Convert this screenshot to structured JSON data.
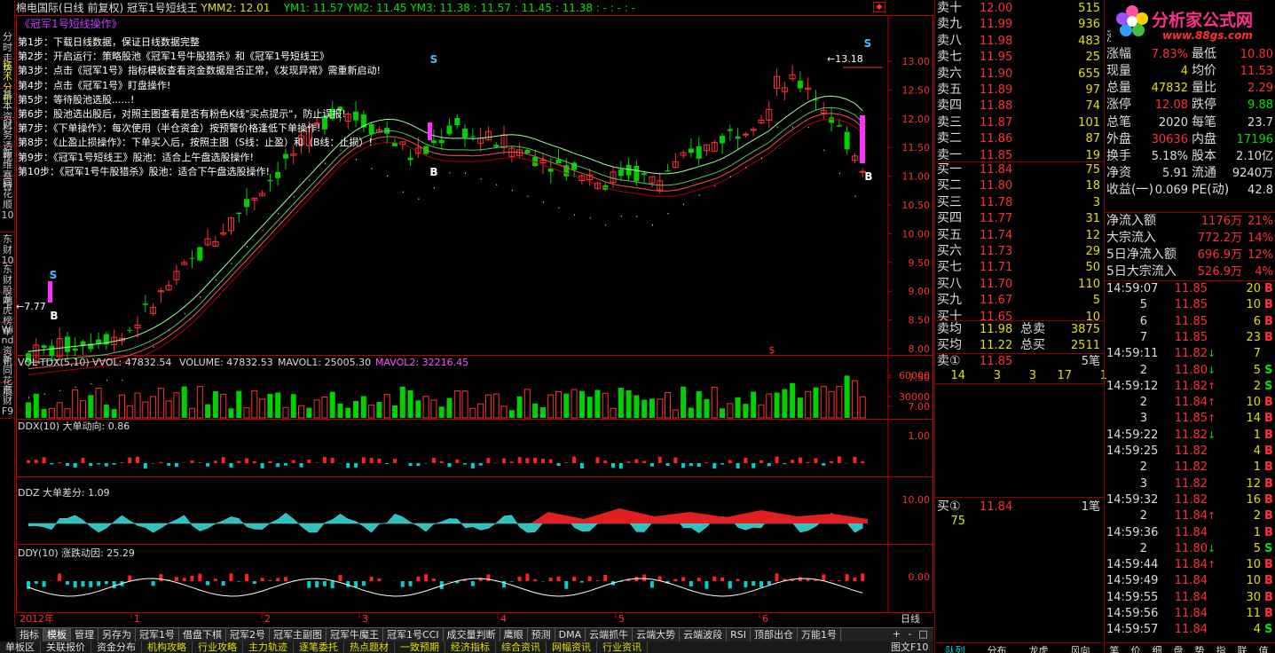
{
  "left_tabs": [
    "分时走势",
    "技术分析",
    "基本资料",
    "财务透视",
    "新维赛特",
    "同花顺10",
    "东财10",
    "东财股吧",
    "龙虎榜单",
    "Wind资讯",
    "新同花顺",
    "东财F9"
  ],
  "title": {
    "app": "棉电国际(日线 前复权)",
    "indicator": "冠军1号短线王",
    "ymm2": "YMM2: 12.01",
    "ym1": "YM1: 11.57",
    "ym2": "YM2: 11.45",
    "ym3": "YM3: 11.38",
    "extra": ": 11.57  : 11.45  : 11.38  : -  : -  : -"
  },
  "chart_title": "《冠军1号短线操作》",
  "steps": [
    "第1步：下载日线数据，保证日线数据完整",
    "第2步：开启运行：策略股池《冠军1号牛股猎杀》和《冠军1号短线王》",
    "第3步：点击《冠军1号》指标模板查看资金数据是否正常，《发现异常》需重新启动!",
    "第4步：点击《冠军1号》盯盘操作!",
    "第5步：等待股池选股......!",
    "第6步：股池选出股后，对照主图查看是否有粉色K线\"买点提示\"，防止误报!",
    "第7步：《下单操作》：每次使用（半仓资金）按预警价格逢低下单操作!",
    "第8步：《止盈止损操作》：下单买入后，按照主图（S线：止盈）和（B线：止损）!",
    "第9步：《冠军1号短线王》股池：适合上午盘选股操作!",
    "第10步：《冠军1号牛股猎杀》股池：适合下午盘选股操作!"
  ],
  "price_axis": [
    "13.00",
    "12.50",
    "12.00",
    "11.50",
    "11.00",
    "10.50",
    "10.00",
    "9.50",
    "9.00",
    "8.50",
    "8.00",
    "7.50",
    "7.00"
  ],
  "price_marks": {
    "high": "13.18",
    "low": "7.77",
    "s": "S",
    "b": "B"
  },
  "vol_header": {
    "name": "VOL-TDX(5,10)",
    "vvol": "VVOL: 47832.54",
    "volume": "VOLUME: 47832.53",
    "mavol1": "MAVOL1: 25005.30",
    "mavol2": "MAVOL2: 32216.45"
  },
  "vol_axis": [
    "60000",
    "30000"
  ],
  "ddx_header": "DDX(10) 大单动向: 0.86",
  "ddx_axis": [
    "1.00"
  ],
  "ddz_header": "DDZ 大单差分: 1.09",
  "ddz_axis": [
    "10.00"
  ],
  "ddy_header": "DDY(10) 涨跌动因: 25.29",
  "ddy_axis": [
    "0.00"
  ],
  "x_axis": {
    "year": "2012年",
    "months": [
      "1",
      "2",
      "3",
      "4",
      "5",
      "6"
    ],
    "period": "日线"
  },
  "bottom_tabs": [
    "指标",
    "模板",
    "管理",
    "另存为",
    "冠军1号",
    "借盘下棋",
    "冠军2号",
    "冠军主副图",
    "冠军牛魔王",
    "冠军1号CCI",
    "成交量判断",
    "鹰眼",
    "预测",
    "DMA",
    "云端抓牛",
    "云端大势",
    "云端波段",
    "RSI",
    "顶部出仓",
    "万能1号"
  ],
  "news_tabs": [
    "单板区",
    "关联报价",
    "资金分布",
    "机构攻略",
    "行业攻略",
    "主力轨迹",
    "逐笔委托",
    "热点题材",
    "一致预期",
    "经济指标",
    "综合资讯",
    "网幅资讯",
    "行业资讯"
  ],
  "orderbook": {
    "sells": [
      {
        "label": "卖十",
        "price": "12.00",
        "vol": "515"
      },
      {
        "label": "卖九",
        "price": "11.99",
        "vol": "936"
      },
      {
        "label": "卖八",
        "price": "11.98",
        "vol": "483"
      },
      {
        "label": "卖七",
        "price": "11.95",
        "vol": "25"
      },
      {
        "label": "卖六",
        "price": "11.90",
        "vol": "655"
      },
      {
        "label": "卖五",
        "price": "11.89",
        "vol": "97"
      },
      {
        "label": "卖四",
        "price": "11.88",
        "vol": "74"
      },
      {
        "label": "卖三",
        "price": "11.87",
        "vol": "101"
      },
      {
        "label": "卖二",
        "price": "11.86",
        "vol": "87"
      },
      {
        "label": "卖一",
        "price": "11.85",
        "vol": "19"
      }
    ],
    "buys": [
      {
        "label": "买一",
        "price": "11.84",
        "vol": "75"
      },
      {
        "label": "买二",
        "price": "11.80",
        "vol": "18"
      },
      {
        "label": "买三",
        "price": "11.78",
        "vol": "3"
      },
      {
        "label": "买四",
        "price": "11.77",
        "vol": "31"
      },
      {
        "label": "买五",
        "price": "11.74",
        "vol": "12"
      },
      {
        "label": "买六",
        "price": "11.73",
        "vol": "29"
      },
      {
        "label": "买七",
        "price": "11.71",
        "vol": "50"
      },
      {
        "label": "买八",
        "price": "11.70",
        "vol": "110"
      },
      {
        "label": "买九",
        "price": "11.67",
        "vol": "5"
      },
      {
        "label": "买十",
        "price": "11.65",
        "vol": "10"
      }
    ],
    "avg_sell": {
      "label": "卖均",
      "price": "11.98",
      "tlabel": "总卖",
      "total": "3875"
    },
    "avg_buy": {
      "label": "买均",
      "price": "11.22",
      "tlabel": "总买",
      "total": "2511"
    },
    "sell1_queue": {
      "label": "卖①",
      "price": "11.85",
      "count": "5笔",
      "items": [
        "14",
        "3",
        "3",
        "17",
        "1"
      ]
    },
    "buy1_queue": {
      "label": "买①",
      "price": "11.84",
      "count": "1笔",
      "items": [
        "75"
      ]
    }
  },
  "logo": {
    "text": "分析家公式网",
    "url": "www.88gs.com"
  },
  "info": [
    {
      "l1": "涨跌",
      "v1": "0.86",
      "l2": "开盘",
      "v2": "11.00"
    },
    {
      "l1": "涨幅",
      "v1": "7.83%",
      "l2": "最低",
      "v2": "10.80"
    },
    {
      "l1": "现量",
      "v1": "4",
      "l2": "均价",
      "v2": "11.53"
    },
    {
      "l1": "总量",
      "v1": "47832",
      "l2": "量比",
      "v2": "2.29"
    },
    {
      "l1": "涨停",
      "v1": "12.08",
      "l2": "跌停",
      "v2": "9.88"
    },
    {
      "l1": "总笔",
      "v1": "2020",
      "l2": "每笔",
      "v2": "23.7"
    },
    {
      "l1": "外盘",
      "v1": "30636",
      "l2": "内盘",
      "v2": "17196"
    },
    {
      "l1": "换手",
      "v1": "5.18%",
      "l2": "股本",
      "v2": "2.10亿"
    },
    {
      "l1": "净资",
      "v1": "5.91",
      "l2": "流通",
      "v2": "9240万"
    },
    {
      "l1": "收益(一)",
      "v1": "0.069",
      "l2": "PE(动)",
      "v2": "42.8"
    }
  ],
  "flows": [
    {
      "l": "净流入额",
      "v": "1176万",
      "p": "21%"
    },
    {
      "l": "大宗流入",
      "v": "772.2万",
      "p": "14%"
    },
    {
      "l": "5日净流入额",
      "v": "696.9万",
      "p": "12%"
    },
    {
      "l": "5日大宗流入",
      "v": "526.9万",
      "p": "4%"
    }
  ],
  "ticks": [
    {
      "t": "14:59:07",
      "p": "11.85",
      "a": "",
      "v": "20",
      "s": "B"
    },
    {
      "t": "5",
      "p": "11.85",
      "a": "",
      "v": "10",
      "s": "B"
    },
    {
      "t": "6",
      "p": "11.85",
      "a": "",
      "v": "6",
      "s": "B"
    },
    {
      "t": "7",
      "p": "11.85",
      "a": "",
      "v": "23",
      "s": "B"
    },
    {
      "t": "14:59:11",
      "p": "11.82",
      "a": "↓",
      "v": "7",
      "s": ""
    },
    {
      "t": "2",
      "p": "11.80",
      "a": "↓",
      "v": "5",
      "s": "S"
    },
    {
      "t": "14:59:12",
      "p": "11.82",
      "a": "↑",
      "v": "2",
      "s": "S"
    },
    {
      "t": "2",
      "p": "11.84",
      "a": "↑",
      "v": "10",
      "s": "B"
    },
    {
      "t": "3",
      "p": "11.85",
      "a": "↑",
      "v": "14",
      "s": "B"
    },
    {
      "t": "14:59:22",
      "p": "11.82",
      "a": "↓",
      "v": "1",
      "s": "B"
    },
    {
      "t": "14:59:25",
      "p": "11.82",
      "a": "",
      "v": "4",
      "s": "B"
    },
    {
      "t": "2",
      "p": "11.82",
      "a": "",
      "v": "1",
      "s": "B"
    },
    {
      "t": "3",
      "p": "11.82",
      "a": "",
      "v": "12",
      "s": "B"
    },
    {
      "t": "14:59:32",
      "p": "11.82",
      "a": "",
      "v": "16",
      "s": "B"
    },
    {
      "t": "2",
      "p": "11.84",
      "a": "↑",
      "v": "2",
      "s": "B"
    },
    {
      "t": "14:59:36",
      "p": "11.84",
      "a": "",
      "v": "1",
      "s": "B"
    },
    {
      "t": "2",
      "p": "11.80",
      "a": "↓",
      "v": "5",
      "s": "S"
    },
    {
      "t": "14:59:44",
      "p": "11.84",
      "a": "↑",
      "v": "10",
      "s": "B"
    },
    {
      "t": "14:59:49",
      "p": "11.84",
      "a": "",
      "v": "10",
      "s": "B"
    },
    {
      "t": "14:59:55",
      "p": "11.84",
      "a": "",
      "v": "30",
      "s": "B"
    },
    {
      "t": "14:59:56",
      "p": "11.84",
      "a": "",
      "v": "11",
      "s": "B"
    },
    {
      "t": "14:59:57",
      "p": "11.84",
      "a": "",
      "v": "4",
      "s": "S"
    }
  ],
  "ob_tabs": [
    "队列",
    "分布",
    "龙虎",
    "风向"
  ],
  "info_tabs": [
    "笔",
    "价",
    "细",
    "盘",
    "势",
    "指",
    "联",
    "值"
  ],
  "bottom_right": "图文F10",
  "plus_minus": [
    "+",
    "-",
    "□"
  ]
}
